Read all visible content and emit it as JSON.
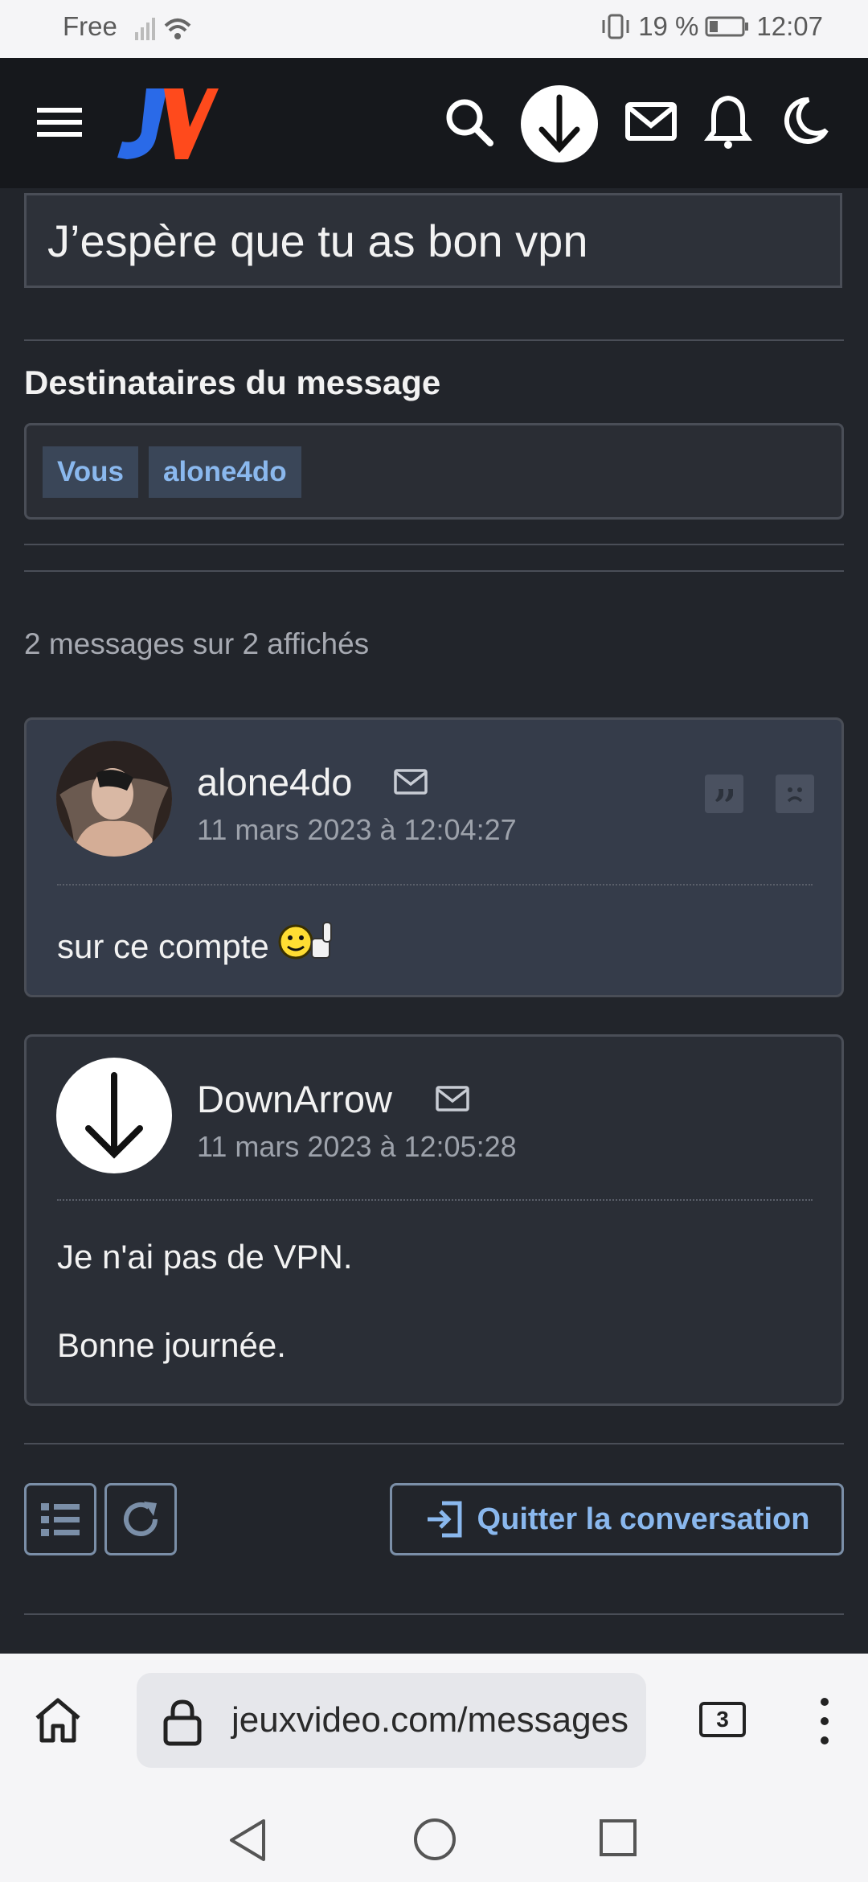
{
  "status_bar": {
    "carrier": "Free",
    "battery": "19 %",
    "time": "12:07"
  },
  "header": {
    "logo_text": "JV"
  },
  "topic": {
    "title": "J’espère que tu as bon vpn"
  },
  "recipients": {
    "heading": "Destinataires du message",
    "tags": [
      "Vous",
      "alone4do"
    ]
  },
  "messages_count": "2 messages sur 2 affichés",
  "messages": [
    {
      "author": "alone4do",
      "date": "11 mars 2023 à 12:04:27",
      "body": [
        "sur ce compte"
      ]
    },
    {
      "author": "DownArrow",
      "date": "11 mars 2023 à 12:05:28",
      "body": [
        "Je n'ai pas de VPN.",
        "Bonne journée."
      ]
    }
  ],
  "actions": {
    "quit_label": "Quitter la conversation"
  },
  "browser": {
    "url": "jeuxvideo.com/messages",
    "tab_count": "3"
  },
  "colors": {
    "accent_blue": "#8ab8ee",
    "logo_orange": "#ff4a1c",
    "logo_blue": "#2a6ae8"
  }
}
